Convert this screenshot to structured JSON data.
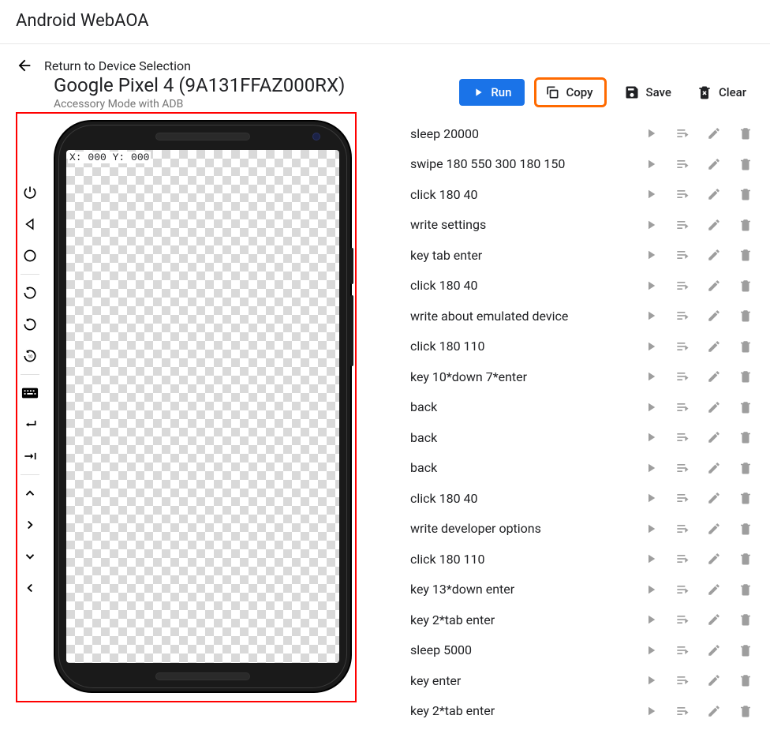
{
  "app_title": "Android WebAOA",
  "return_label": "Return to Device Selection",
  "device": {
    "title": "Google Pixel 4 (9A131FFAZ000RX)",
    "subtitle": "Accessory Mode with ADB",
    "coords": "X: 000 Y: 000"
  },
  "actions": {
    "run": "Run",
    "copy": "Copy",
    "save": "Save",
    "clear": "Clear"
  },
  "side_tools": [
    {
      "name": "power-icon"
    },
    {
      "name": "back-nav-icon"
    },
    {
      "name": "home-icon"
    },
    {
      "sep": true
    },
    {
      "name": "rotate-cw-icon"
    },
    {
      "name": "rotate-ccw-icon"
    },
    {
      "name": "rotate-timer-icon"
    },
    {
      "sep": true
    },
    {
      "name": "keyboard-icon"
    },
    {
      "name": "enter-icon"
    },
    {
      "name": "tab-icon"
    },
    {
      "sep": true
    },
    {
      "name": "chevron-up-icon"
    },
    {
      "name": "chevron-right-icon"
    },
    {
      "name": "chevron-down-icon"
    },
    {
      "name": "chevron-left-icon"
    }
  ],
  "commands": [
    "sleep 20000",
    "swipe 180 550 300 180 150",
    "click 180 40",
    "write settings",
    "key tab enter",
    "click 180 40",
    "write about emulated device",
    "click 180 110",
    "key 10*down 7*enter",
    "back",
    "back",
    "back",
    "click 180 40",
    "write developer options",
    "click 180 110",
    "key 13*down enter",
    "key 2*tab enter",
    "sleep 5000",
    "key enter",
    "key 2*tab enter"
  ]
}
